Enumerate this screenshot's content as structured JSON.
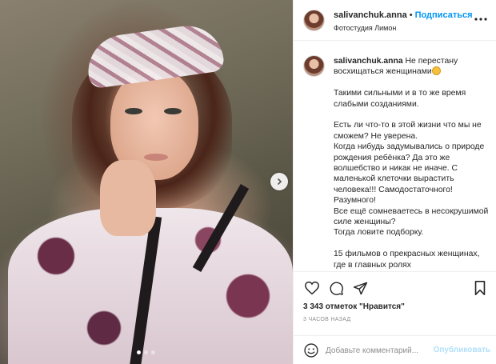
{
  "header": {
    "username": "salivanchuk.anna",
    "separator": "•",
    "follow_label": "Подписаться",
    "location": "Фотостудия Лимон"
  },
  "caption": {
    "username": "salivanchuk.anna",
    "first_line": "Не перестану восхищаться женщинами",
    "paragraphs": [
      "Такими сильными и в то же время слабыми созданиями.",
      "Есть ли что-то в этой жизни что мы не сможем? Не уверена.\nКогда нибудь задумывались о природе рождения ребёнка? Да это же волшебство и никак не иначе. С маленькой клеточки вырастить человека!!! Самодостаточного! Разумного!\nВсе ещё сомневаетесь в несокрушимой силе женщины?\nТогда ловите подборку.",
      "15 фильмов о прекрасных женщинах, где в главных ролях"
    ]
  },
  "stats": {
    "likes_text": "3 343 отметок \"Нравится\"",
    "time_text": "3 ЧАСОВ НАЗАД"
  },
  "comment": {
    "placeholder": "Добавьте комментарий...",
    "publish_label": "Опубликовать"
  },
  "carousel": {
    "total": 3,
    "active": 1
  },
  "colors": {
    "accent": "#0095f6",
    "publish_disabled": "#b2dffc",
    "muted": "#8e8e8e",
    "border": "#efefef"
  }
}
